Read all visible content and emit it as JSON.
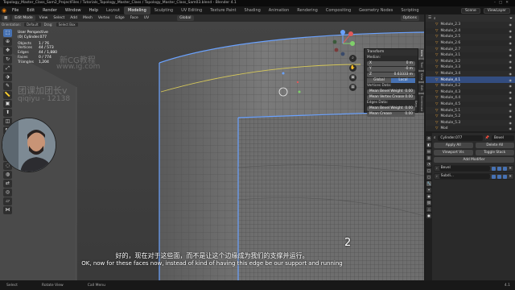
{
  "titlebar": {
    "text": "Topology_Master_Class_Sam2_ProjectFiles / Tutorials_Topology_Master_Class / Topology_Master_Class_Sam03.blend - Blender 4.1"
  },
  "menubar": {
    "menus": [
      "File",
      "Edit",
      "Render",
      "Window",
      "Help"
    ],
    "workspaces": [
      "Layout",
      "Modeling",
      "Sculpting",
      "UV Editing",
      "Texture Paint",
      "Shading",
      "Animation",
      "Rendering",
      "Compositing",
      "Geometry Nodes",
      "Scripting"
    ],
    "active_workspace": "Modeling",
    "scene": "Scene",
    "view_layer": "ViewLayer"
  },
  "viewport_header": {
    "mode": "Edit Mode",
    "menus": [
      "View",
      "Select",
      "Add",
      "Mesh",
      "Vertex",
      "Edge",
      "Face",
      "UV"
    ],
    "transform": "Global",
    "options": "Options",
    "orientation_label": "Orientation:",
    "orientation_value": "Default",
    "drag_label": "Drag:",
    "drag_value": "Select Box"
  },
  "overlay": {
    "view_name": "User Perspective",
    "object_name": "(0) Cylinder.077",
    "stats": [
      {
        "k": "Objects",
        "v": "1 / 76"
      },
      {
        "k": "Vertices",
        "v": "44 / 573"
      },
      {
        "k": "Edges",
        "v": "44 / 1,880"
      },
      {
        "k": "Faces",
        "v": "0 / 774"
      },
      {
        "k": "Triangles",
        "v": "1,204"
      }
    ]
  },
  "watermark": {
    "line1": "新CG教程",
    "line2": "www.ig.com",
    "line3": "团课加团长v",
    "line4": "qiqiyu - 12138"
  },
  "npanel": {
    "header": "Transform",
    "median_label": "Median:",
    "fields": [
      {
        "k": "X",
        "v": "0 m"
      },
      {
        "k": "Y",
        "v": "-0 m"
      },
      {
        "k": "Z",
        "v": "0.63333 m"
      }
    ],
    "toggle": [
      "Global",
      "Local"
    ],
    "vertices_data": "Vertices Data:",
    "vertex_fields": [
      {
        "k": "Mean Bevel Weight",
        "v": "0.00"
      },
      {
        "k": "Mean Vertex Crease",
        "v": "0.00"
      }
    ],
    "edges_data": "Edges Data:",
    "edge_fields": [
      {
        "k": "Mean Bevel Weight",
        "v": "0.00"
      },
      {
        "k": "Mean Crease",
        "v": "0.00"
      }
    ],
    "tabs": [
      "Item",
      "Tool",
      "View",
      "Edit",
      "Screencast Keys"
    ]
  },
  "outliner": {
    "items": [
      "Module_2.3",
      "Module_2.4",
      "Module_2.5",
      "Module_2.6",
      "Module_2.7",
      "Module_3.1",
      "Module_3.2",
      "Module_3.3",
      "Module_3.4",
      "Module_4.1",
      "Module_4.2",
      "Module_4.3",
      "Module_4.4",
      "Module_4.5",
      "Module_5.1",
      "Module_5.2",
      "Module_5.3",
      "Mod"
    ],
    "selected_index": 9
  },
  "properties": {
    "object": "Cylinder.077",
    "modifier_type": "Bevel",
    "apply_all": "Apply All",
    "delete_all": "Delete All",
    "viewport_vis": "Viewport Vis",
    "toggle_stack": "Toggle Stack",
    "add_modifier": "Add Modifier",
    "modifiers": [
      "Bevel",
      "Subdi..."
    ]
  },
  "statusbar": {
    "items": [
      "Select",
      "Rotate View",
      "Call Menu"
    ],
    "version": "4.1"
  },
  "subtitles": {
    "chinese": "好的，现在对于这些面，而不是让这个边缘成为我们的支撑并运行。",
    "english": "OK, now for these faces now, instead of kind of having this edge be our support and running",
    "side_number": "2"
  },
  "colors": {
    "accent": "#4772b3",
    "blender_orange": "#e87d0d",
    "selection": "#6aa2ff"
  }
}
